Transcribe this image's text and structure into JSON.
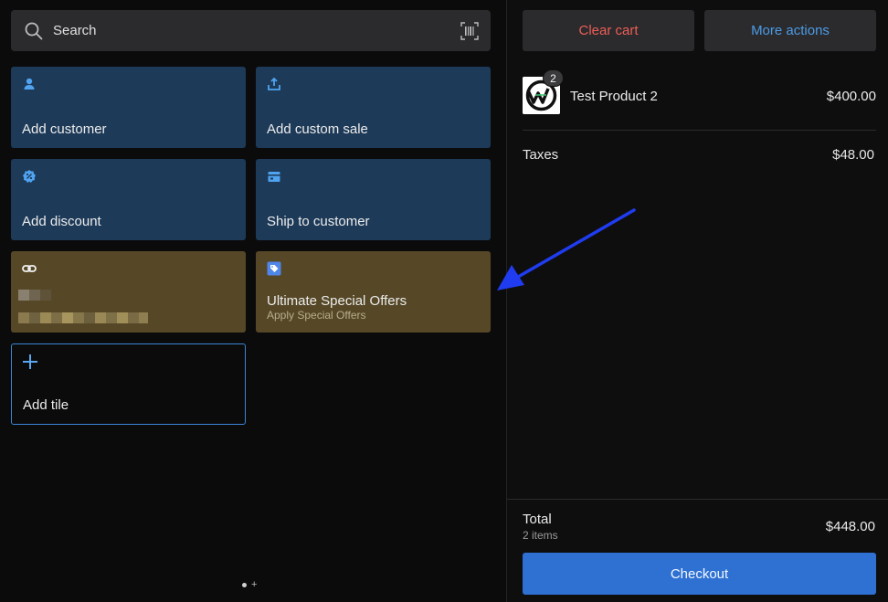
{
  "search": {
    "placeholder": "Search"
  },
  "tiles": [
    {
      "label": "Add customer",
      "icon": "person-icon"
    },
    {
      "label": "Add custom sale",
      "icon": "upload-tray-icon"
    },
    {
      "label": "Add discount",
      "icon": "discount-badge-icon"
    },
    {
      "label": "Ship to customer",
      "icon": "shipping-box-icon"
    },
    {
      "label": "",
      "icon": "link-icon",
      "obscured": true
    },
    {
      "label": "Ultimate Special Offers",
      "sublabel": "Apply Special Offers",
      "icon": "tag-icon"
    },
    {
      "label": "Add tile",
      "icon": "plus-icon"
    }
  ],
  "actions": {
    "clear_cart": "Clear cart",
    "more_actions": "More actions"
  },
  "cart": {
    "items": [
      {
        "name": "Test Product 2",
        "quantity": "2",
        "price": "$400.00"
      }
    ],
    "taxes_label": "Taxes",
    "taxes_value": "$48.00",
    "total_label": "Total",
    "items_count": "2 items",
    "total_value": "$448.00",
    "checkout_label": "Checkout"
  },
  "colors": {
    "accent": "#2e71d3",
    "tile_blue": "#1d3a58",
    "tile_olive": "#564827",
    "danger": "#ee5d57",
    "link": "#4b9be6",
    "annotation_arrow": "#1f3cf0"
  }
}
